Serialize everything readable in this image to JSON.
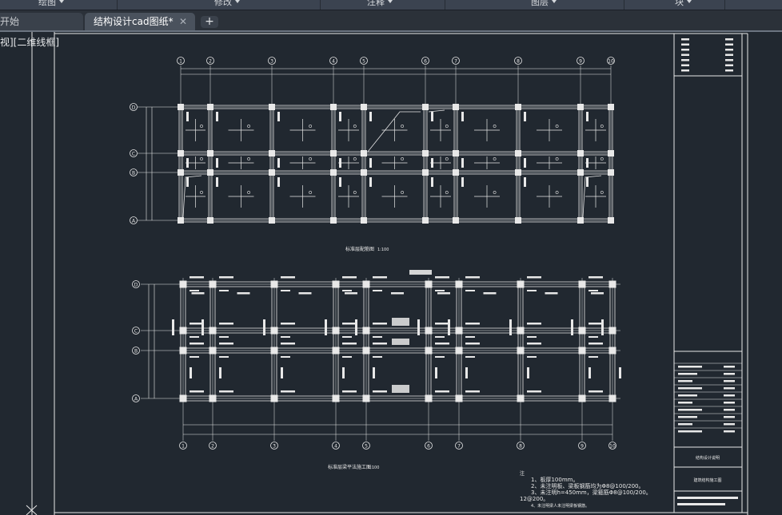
{
  "ribbon": {
    "panels": [
      {
        "label": "绘图"
      },
      {
        "label": "修改"
      },
      {
        "label": "注释"
      },
      {
        "label": "图层"
      },
      {
        "label": "块"
      }
    ]
  },
  "tabs": {
    "start_label": "开始",
    "active_label": "结构设计cad图纸*",
    "close_glyph": "✕",
    "add_glyph": "+"
  },
  "viewport": {
    "label": "视][二维线框]"
  },
  "drawing": {
    "plan1": {
      "axis_top": [
        "1",
        "2",
        "3",
        "4",
        "5",
        "6",
        "7",
        "8",
        "9",
        "10"
      ],
      "axis_left": [
        "D",
        "C",
        "B",
        "A"
      ],
      "caption": "标准层配筋图",
      "scale": "1:100"
    },
    "plan2": {
      "axis_bottom": [
        "1",
        "2",
        "3",
        "4",
        "5",
        "6",
        "7",
        "8",
        "9",
        "10"
      ],
      "axis_left": [
        "D",
        "C",
        "B",
        "A"
      ],
      "caption": "标准层梁平法施工图",
      "scale": "1:100"
    },
    "notes": {
      "title": "注",
      "lines": [
        "1、板厚100mm。",
        "2、未注明板、梁板钢筋均为Φ8@100/200。",
        "3、未注明h=450mm，梁箍筋Φ8@100/200。",
        "12@200。",
        "4、未注明梁人未注明梁板钢筋。"
      ]
    },
    "title_block": {
      "project": "结构设计说明",
      "sheet": "建筑结构施工图"
    }
  }
}
